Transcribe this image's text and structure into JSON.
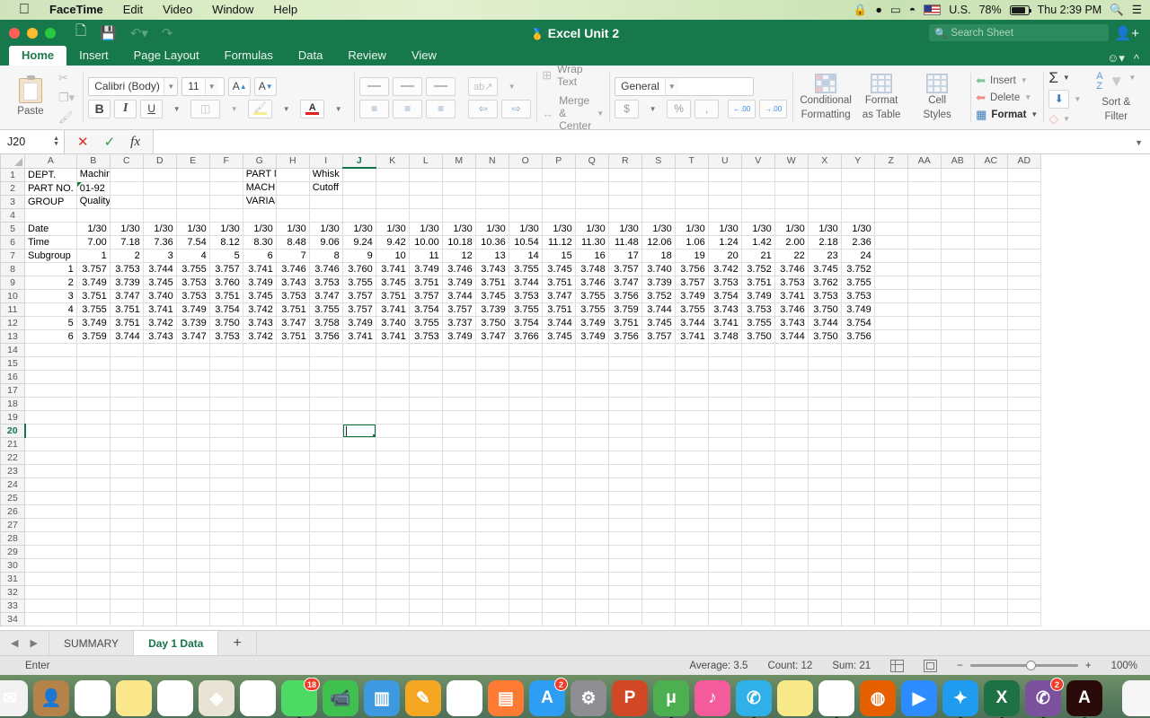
{
  "macbar": {
    "apple_icon": "apple-icon",
    "menus": [
      "FaceTime",
      "Edit",
      "Video",
      "Window",
      "Help"
    ],
    "status": {
      "lock_icon": "lock-icon",
      "notification_icon": "notification-icon",
      "airplay_icon": "airplay-icon",
      "wifi_icon": "wifi-icon",
      "flag_icon": "us-flag-icon",
      "input_source": "U.S.",
      "battery_percent": "78%",
      "battery_icon": "battery-icon",
      "clock": "Thu 2:39 PM",
      "spotlight_icon": "search-icon",
      "notification_center_icon": "list-icon"
    }
  },
  "window": {
    "title": "Excel Unit 2",
    "app_icon": "excel-icon",
    "quick_access": [
      "sidebar-icon",
      "save-icon",
      "undo-icon",
      "redo-icon"
    ],
    "search_placeholder": "Search Sheet",
    "share_icon": "add-user-icon"
  },
  "ribbon": {
    "tabs": [
      "Home",
      "Insert",
      "Page Layout",
      "Formulas",
      "Data",
      "Review",
      "View"
    ],
    "active_tab": "Home",
    "help_icon": "smiley-icon",
    "collapse_icon": "chevron-up-icon",
    "clipboard": {
      "paste_label": "Paste",
      "cut_icon": "scissors-icon",
      "copy_icon": "copy-icon",
      "format_painter_icon": "paintbrush-icon"
    },
    "font": {
      "family": "Calibri (Body)",
      "size": "11",
      "grow_label": "A",
      "shrink_label": "A",
      "bold_label": "B",
      "italic_label": "I",
      "underline_label": "U",
      "borders_icon": "borders-icon",
      "fill_icon": "fill-color-icon",
      "font_color_icon": "font-color-icon",
      "font_color": "#e02020",
      "fill_color": "#f0ef8e"
    },
    "alignment": {
      "wrap_text": "Wrap Text",
      "merge_center": "Merge & Center",
      "orientation_icon": "orientation-icon",
      "top_align_icon": "align-top-icon",
      "middle_align_icon": "align-middle-icon",
      "bottom_align_icon": "align-bottom-icon",
      "align_left_icon": "align-left-icon",
      "align_center_icon": "align-center-icon",
      "align_right_icon": "align-right-icon",
      "decrease_indent_icon": "decrease-indent-icon",
      "increase_indent_icon": "increase-indent-icon"
    },
    "number": {
      "format": "General",
      "currency_label": "$",
      "percent_label": "%",
      "comma_label": ",",
      "decrease_decimal": ".00",
      "increase_decimal": ".00"
    },
    "styles": {
      "conditional_formatting": "Conditional\nFormatting",
      "conditional_line1": "Conditional",
      "conditional_line2": "Formatting",
      "format_as_table_line1": "Format",
      "format_as_table_line2": "as Table",
      "cell_styles_line1": "Cell",
      "cell_styles_line2": "Styles"
    },
    "cells": {
      "insert": "Insert",
      "delete": "Delete",
      "format": "Format"
    },
    "editing": {
      "autosum_icon": "sigma-icon",
      "fill_icon": "fill-down-icon",
      "clear_icon": "eraser-icon",
      "sort_filter_line1": "Sort &",
      "sort_filter_line2": "Filter",
      "sort_az_label": "A\nZ"
    }
  },
  "formula_bar": {
    "name_box": "J20",
    "cancel_icon": "cancel-icon",
    "confirm_icon": "confirm-icon",
    "function_icon": "fx-icon",
    "formula_value": "",
    "expand_icon": "chevron-down-icon"
  },
  "grid": {
    "columns": [
      "A",
      "B",
      "C",
      "D",
      "E",
      "F",
      "G",
      "H",
      "I",
      "J",
      "K",
      "L",
      "M",
      "N",
      "O",
      "P",
      "Q",
      "R",
      "S",
      "T",
      "U",
      "V",
      "W",
      "X",
      "Y",
      "Z",
      "AA",
      "AB",
      "AC",
      "AD"
    ],
    "selected_column": "J",
    "selected_row": 20,
    "selected_cell": "J20",
    "row_count": 34,
    "header_rows": [
      {
        "row": 1,
        "a": "DEPT.",
        "b": "Machine",
        "g": "PART NAME",
        "i": "Whisk Wheel"
      },
      {
        "row": 2,
        "a": "PART NO.",
        "b": "01-92",
        "g": "MACHINE",
        "i": "Cutoff"
      },
      {
        "row": 3,
        "a": "GROUP",
        "b": "Quality Control",
        "g": "VARIABLE",
        "i": ""
      }
    ],
    "date_label": "Date",
    "time_label": "Time",
    "subgroup_label": "Subgroup",
    "dates": [
      "1/30",
      "1/30",
      "1/30",
      "1/30",
      "1/30",
      "1/30",
      "1/30",
      "1/30",
      "1/30",
      "1/30",
      "1/30",
      "1/30",
      "1/30",
      "1/30",
      "1/30",
      "1/30",
      "1/30",
      "1/30",
      "1/30",
      "1/30",
      "1/30",
      "1/30",
      "1/30",
      "1/30"
    ],
    "times": [
      "7.00",
      "7.18",
      "7.36",
      "7.54",
      "8.12",
      "8.30",
      "8.48",
      "9.06",
      "9.24",
      "9.42",
      "10.00",
      "10.18",
      "10.36",
      "10.54",
      "11.12",
      "11.30",
      "11.48",
      "12.06",
      "1.06",
      "1.24",
      "1.42",
      "2.00",
      "2.18",
      "2.36"
    ],
    "subgroups": [
      "1",
      "2",
      "3",
      "4",
      "5",
      "6",
      "7",
      "8",
      "9",
      "10",
      "11",
      "12",
      "13",
      "14",
      "15",
      "16",
      "17",
      "18",
      "19",
      "20",
      "21",
      "22",
      "23",
      "24"
    ],
    "sample_labels": [
      "1",
      "2",
      "3",
      "4",
      "5",
      "6"
    ],
    "measurements": [
      [
        "3.757",
        "3.753",
        "3.744",
        "3.755",
        "3.757",
        "3.741",
        "3.746",
        "3.746",
        "3.760",
        "3.741",
        "3.749",
        "3.746",
        "3.743",
        "3.755",
        "3.745",
        "3.748",
        "3.757",
        "3.740",
        "3.756",
        "3.742",
        "3.752",
        "3.746",
        "3.745",
        "3.752"
      ],
      [
        "3.749",
        "3.739",
        "3.745",
        "3.753",
        "3.760",
        "3.749",
        "3.743",
        "3.753",
        "3.755",
        "3.745",
        "3.751",
        "3.749",
        "3.751",
        "3.744",
        "3.751",
        "3.746",
        "3.747",
        "3.739",
        "3.757",
        "3.753",
        "3.751",
        "3.753",
        "3.762",
        "3.755"
      ],
      [
        "3.751",
        "3.747",
        "3.740",
        "3.753",
        "3.751",
        "3.745",
        "3.753",
        "3.747",
        "3.757",
        "3.751",
        "3.757",
        "3.744",
        "3.745",
        "3.753",
        "3.747",
        "3.755",
        "3.756",
        "3.752",
        "3.749",
        "3.754",
        "3.749",
        "3.741",
        "3.753",
        "3.753"
      ],
      [
        "3.755",
        "3.751",
        "3.741",
        "3.749",
        "3.754",
        "3.742",
        "3.751",
        "3.755",
        "3.757",
        "3.741",
        "3.754",
        "3.757",
        "3.739",
        "3.755",
        "3.751",
        "3.755",
        "3.759",
        "3.744",
        "3.755",
        "3.743",
        "3.753",
        "3.746",
        "3.750",
        "3.749"
      ],
      [
        "3.749",
        "3.751",
        "3.742",
        "3.739",
        "3.750",
        "3.743",
        "3.747",
        "3.758",
        "3.749",
        "3.740",
        "3.755",
        "3.737",
        "3.750",
        "3.754",
        "3.744",
        "3.749",
        "3.751",
        "3.745",
        "3.744",
        "3.741",
        "3.755",
        "3.743",
        "3.744",
        "3.754"
      ],
      [
        "3.759",
        "3.744",
        "3.743",
        "3.747",
        "3.753",
        "3.742",
        "3.751",
        "3.756",
        "3.741",
        "3.741",
        "3.753",
        "3.749",
        "3.747",
        "3.766",
        "3.745",
        "3.749",
        "3.756",
        "3.757",
        "3.741",
        "3.748",
        "3.750",
        "3.744",
        "3.750",
        "3.756"
      ]
    ]
  },
  "sheet_tabs": {
    "prev_icon": "prev-sheet-icon",
    "next_icon": "next-sheet-icon",
    "tabs": [
      "SUMMARY",
      "Day 1 Data"
    ],
    "active": "Day 1 Data",
    "add_label": "+"
  },
  "status_bar": {
    "mode": "Enter",
    "average": "Average: 3.5",
    "count": "Count: 12",
    "sum": "Sum: 21",
    "normal_view_icon": "normal-view-icon",
    "page_layout_icon": "page-layout-icon",
    "zoom_out": "−",
    "zoom_in": "+",
    "zoom_level": "100%"
  },
  "dock": {
    "items": [
      {
        "name": "finder-icon",
        "color": "#3aa0e8",
        "glyph": "☺",
        "running": true
      },
      {
        "name": "launchpad-icon",
        "color": "#c9ccd1",
        "glyph": "🚀",
        "running": false
      },
      {
        "name": "mail-icon",
        "color": "#f2f2f2",
        "glyph": "✉",
        "running": false
      },
      {
        "name": "contacts-icon",
        "color": "#b5824a",
        "glyph": "👤",
        "running": false
      },
      {
        "name": "calendar-icon",
        "color": "#ffffff",
        "glyph": "1",
        "running": false
      },
      {
        "name": "notes-icon",
        "color": "#fbe78b",
        "glyph": "",
        "running": false
      },
      {
        "name": "reminders-icon",
        "color": "#ffffff",
        "glyph": "☰",
        "running": false
      },
      {
        "name": "maps-icon",
        "color": "#e8e3d4",
        "glyph": "◈",
        "running": false
      },
      {
        "name": "photos-icon",
        "color": "#ffffff",
        "glyph": "❋",
        "running": false
      },
      {
        "name": "messages-icon",
        "color": "#4cd964",
        "glyph": "",
        "badge": "18",
        "running": true
      },
      {
        "name": "facetime-icon",
        "color": "#3ec14f",
        "glyph": "📹",
        "running": false
      },
      {
        "name": "keynote-icon",
        "color": "#3d9ae0",
        "glyph": "▥",
        "running": false
      },
      {
        "name": "pages-icon",
        "color": "#f5a623",
        "glyph": "✎",
        "running": false
      },
      {
        "name": "numbers-icon",
        "color": "#ffffff",
        "glyph": "▮",
        "running": false
      },
      {
        "name": "ibooks-icon",
        "color": "#ff7a33",
        "glyph": "▤",
        "running": false
      },
      {
        "name": "app-store-icon",
        "color": "#2e9ef4",
        "glyph": "A",
        "badge": "2",
        "running": false
      },
      {
        "name": "system-preferences-icon",
        "color": "#8e8e93",
        "glyph": "⚙",
        "running": false
      },
      {
        "name": "powerpoint-icon",
        "color": "#d24726",
        "glyph": "P",
        "running": false
      },
      {
        "name": "utorrent-icon",
        "color": "#4caf50",
        "glyph": "μ",
        "running": true
      },
      {
        "name": "itunes-icon",
        "color": "#f45b9b",
        "glyph": "♪",
        "running": false
      },
      {
        "name": "skype-icon",
        "color": "#2fb0e8",
        "glyph": "✆",
        "running": true
      },
      {
        "name": "stickies-icon",
        "color": "#f7e98a",
        "glyph": "",
        "running": false
      },
      {
        "name": "chrome-icon",
        "color": "#ffffff",
        "glyph": "◉",
        "running": true
      },
      {
        "name": "firefox-icon",
        "color": "#e66000",
        "glyph": "◍",
        "running": false
      },
      {
        "name": "zoom-icon",
        "color": "#2d8cff",
        "glyph": "▶",
        "running": false
      },
      {
        "name": "safari-icon",
        "color": "#1f9cf0",
        "glyph": "✦",
        "running": true
      },
      {
        "name": "excel-icon",
        "color": "#1e7145",
        "glyph": "X",
        "running": true
      },
      {
        "name": "viber-icon",
        "color": "#7b519d",
        "glyph": "✆",
        "badge": "2",
        "running": true
      },
      {
        "name": "acrobat-icon",
        "color": "#2b0a0a",
        "glyph": "A",
        "running": true
      },
      {
        "name": "separator",
        "color": "",
        "glyph": "",
        "running": false
      },
      {
        "name": "finder-window-stack-icon",
        "color": "#f6f6f6",
        "glyph": "",
        "running": false
      },
      {
        "name": "desktop-window-icon",
        "color": "#4a6c8c",
        "glyph": "",
        "running": false
      },
      {
        "name": "trash-icon",
        "color": "#e8ecee",
        "glyph": "🗑",
        "running": false
      }
    ]
  },
  "colors": {
    "excel_green": "#17784b",
    "accent_green": "#16754a",
    "selection_green": "#11713f"
  }
}
